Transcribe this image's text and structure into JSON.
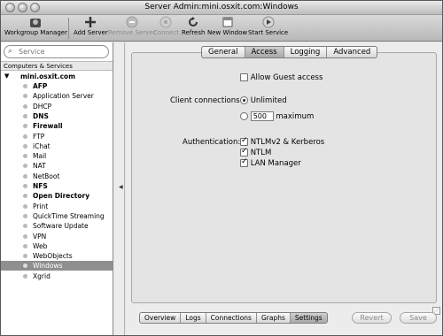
{
  "window": {
    "title": "Server Admin:mini.osxit.com:Windows"
  },
  "toolbar": {
    "workgroup_manager": "Workgroup Manager",
    "add_server": "Add Server",
    "remove_server": "Remove Server",
    "connect": "Connect",
    "refresh": "Refresh",
    "new_window": "New Window",
    "start_service": "Start Service"
  },
  "sidebar": {
    "search_placeholder": "Service",
    "section_header": "Computers & Services",
    "server_name": "mini.osxit.com",
    "services": [
      {
        "label": "AFP",
        "bold": true
      },
      {
        "label": "Application Server",
        "bold": false
      },
      {
        "label": "DHCP",
        "bold": false
      },
      {
        "label": "DNS",
        "bold": true
      },
      {
        "label": "Firewall",
        "bold": true
      },
      {
        "label": "FTP",
        "bold": false
      },
      {
        "label": "iChat",
        "bold": false
      },
      {
        "label": "Mail",
        "bold": false
      },
      {
        "label": "NAT",
        "bold": false
      },
      {
        "label": "NetBoot",
        "bold": false
      },
      {
        "label": "NFS",
        "bold": true
      },
      {
        "label": "Open Directory",
        "bold": true
      },
      {
        "label": "Print",
        "bold": false
      },
      {
        "label": "QuickTime Streaming",
        "bold": false
      },
      {
        "label": "Software Update",
        "bold": false
      },
      {
        "label": "VPN",
        "bold": false
      },
      {
        "label": "Web",
        "bold": false
      },
      {
        "label": "WebObjects",
        "bold": false
      },
      {
        "label": "Windows",
        "bold": false,
        "selected": true
      },
      {
        "label": "Xgrid",
        "bold": false
      }
    ]
  },
  "tabs": [
    "General",
    "Access",
    "Logging",
    "Advanced"
  ],
  "active_tab": "Access",
  "access": {
    "allow_guest_label": "Allow Guest access",
    "allow_guest_checked": false,
    "client_connections_label": "Client connections:",
    "unlimited_label": "Unlimited",
    "unlimited_selected": true,
    "max_value": "500",
    "maximum_label": "maximum",
    "authentication_label": "Authentication:",
    "auth_options": [
      {
        "label": "NTLMv2 & Kerberos",
        "checked": true
      },
      {
        "label": "NTLM",
        "checked": true
      },
      {
        "label": "LAN Manager",
        "checked": true
      }
    ]
  },
  "bottom_tabs": [
    "Overview",
    "Logs",
    "Connections",
    "Graphs",
    "Settings"
  ],
  "active_bottom_tab": "Settings",
  "buttons": {
    "revert": "Revert",
    "save": "Save"
  }
}
